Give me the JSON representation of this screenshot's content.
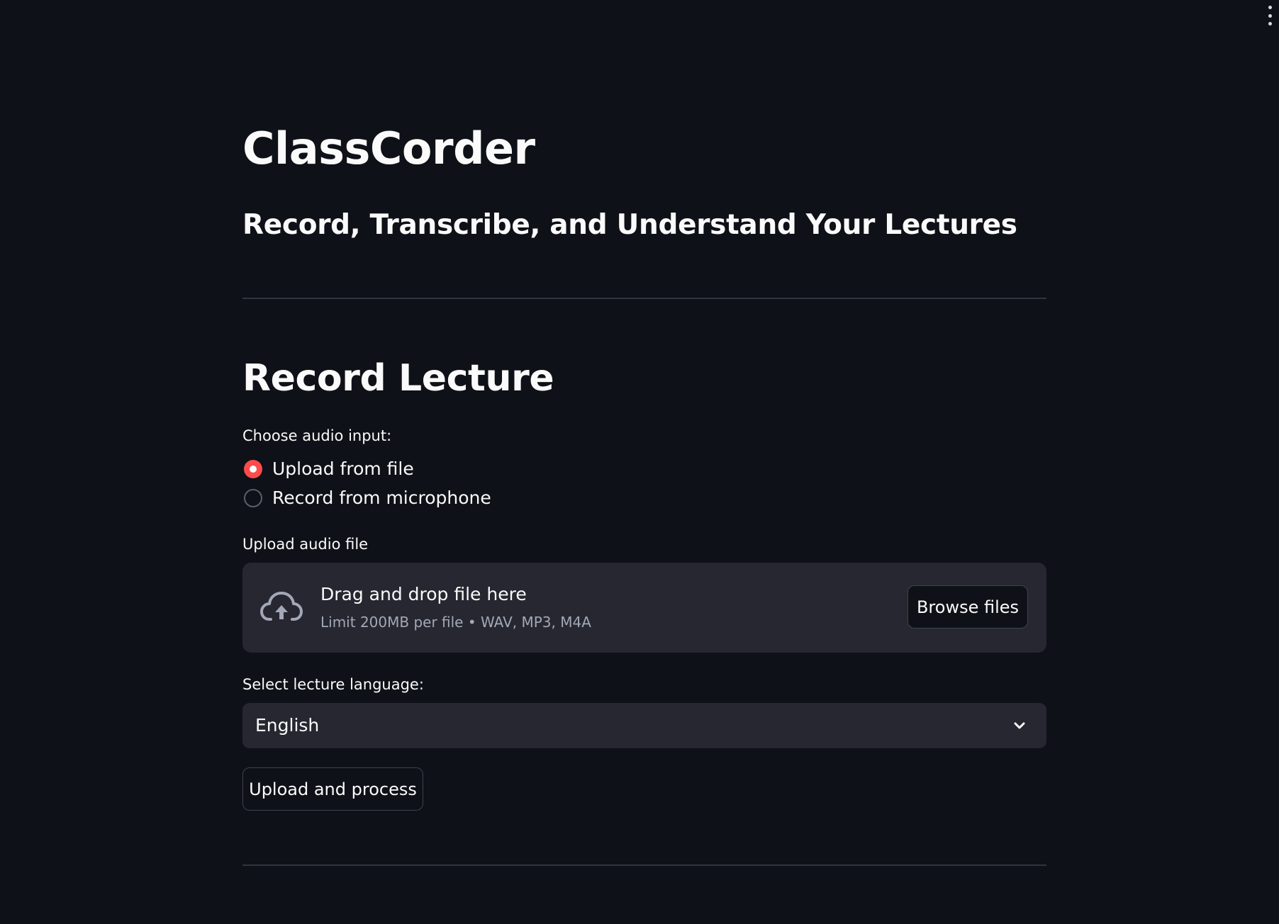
{
  "header": {
    "menu_icon": "vertical-ellipsis-icon"
  },
  "app": {
    "title": "ClassCorder",
    "subtitle": "Record, Transcribe, and Understand Your Lectures"
  },
  "record_section": {
    "title": "Record Lecture",
    "audio_input": {
      "label": "Choose audio input:",
      "selected": "Upload from file",
      "options": [
        {
          "label": "Upload from file",
          "checked": true
        },
        {
          "label": "Record from microphone",
          "checked": false
        }
      ]
    },
    "uploader": {
      "label": "Upload audio file",
      "icon": "cloud-upload-icon",
      "drop_text": "Drag and drop file here",
      "limits": "Limit 200MB per file • WAV, MP3, M4A",
      "browse_label": "Browse files"
    },
    "language": {
      "label": "Select lecture language:",
      "value": "English",
      "icon": "chevron-down-icon"
    },
    "process_button": "Upload and process"
  },
  "colors": {
    "background": "#0e1117",
    "surface": "#262730",
    "accent": "#ff4b4b",
    "text": "#fafafa",
    "muted_text": "#a3a8b8"
  }
}
